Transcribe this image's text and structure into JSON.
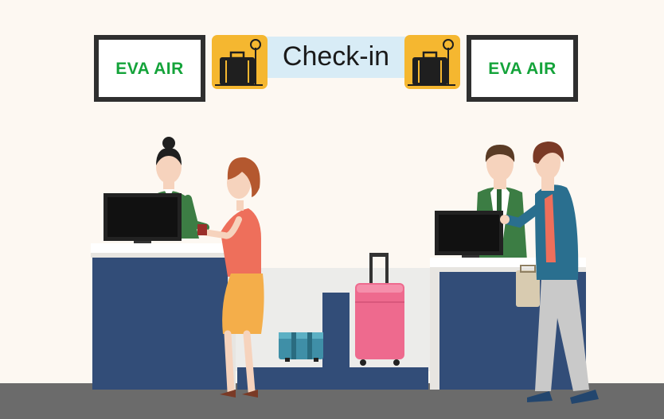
{
  "signage": {
    "left_brand": "EVA AIR",
    "right_brand": "EVA AIR",
    "banner_label": "Check-in",
    "banner_icon": "luggage-scale-icon",
    "banner_color": "#d8ecf6",
    "icon_tile_color": "#f5b730",
    "brand_color": "#14a33a"
  },
  "scene": {
    "wall_color": "#fdf8f2",
    "floor_color": "#6b6b6b",
    "counter_color": "#324d78"
  }
}
